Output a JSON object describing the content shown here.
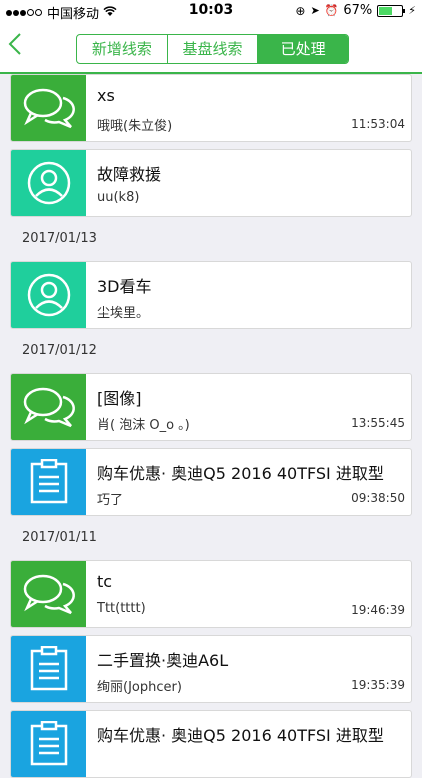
{
  "status_bar": {
    "carrier": "中国移动",
    "time": "10:03",
    "battery": "67%",
    "battery_level": 0.67
  },
  "nav": {
    "back_icon": "chevron-left-icon",
    "tabs": [
      {
        "label": "新增线索",
        "active": false
      },
      {
        "label": "基盘线索",
        "active": false
      },
      {
        "label": "已处理",
        "active": true
      }
    ]
  },
  "items": [
    {
      "kind": "card",
      "icon": "chat-bubbles-icon",
      "color": "green",
      "title": "xs",
      "sub": "哦哦(朱立俊)",
      "time": "11:53:04"
    },
    {
      "kind": "card",
      "icon": "user-icon",
      "color": "teal",
      "title": "故障救援",
      "sub": "uu(k8)",
      "time": ""
    },
    {
      "kind": "date",
      "label": "2017/01/13"
    },
    {
      "kind": "card",
      "icon": "user-icon",
      "color": "teal",
      "title": "3D看车",
      "sub": "尘埃里。",
      "time": ""
    },
    {
      "kind": "date",
      "label": "2017/01/12"
    },
    {
      "kind": "card",
      "icon": "chat-bubbles-icon",
      "color": "green",
      "title": "[图像]",
      "sub": "肖( 泡沫 O_o 。)",
      "time": "13:55:45"
    },
    {
      "kind": "card",
      "icon": "clipboard-icon",
      "color": "blue",
      "title": "购车优惠· 奥迪Q5 2016 40TFSI 进取型",
      "sub": "巧了",
      "time": "09:38:50"
    },
    {
      "kind": "date",
      "label": "2017/01/11"
    },
    {
      "kind": "card",
      "icon": "chat-bubbles-icon",
      "color": "green",
      "title": " tc",
      "sub": "Ttt(tttt)",
      "time": "19:46:39"
    },
    {
      "kind": "card",
      "icon": "clipboard-icon",
      "color": "blue",
      "title": "二手置换·奥迪A6L",
      "sub": "绚丽(Jophcer)",
      "time": "19:35:39"
    },
    {
      "kind": "card",
      "icon": "clipboard-icon",
      "color": "blue",
      "title": "购车优惠· 奥迪Q5 2016 40TFSI 进取型",
      "sub": "",
      "time": ""
    }
  ]
}
